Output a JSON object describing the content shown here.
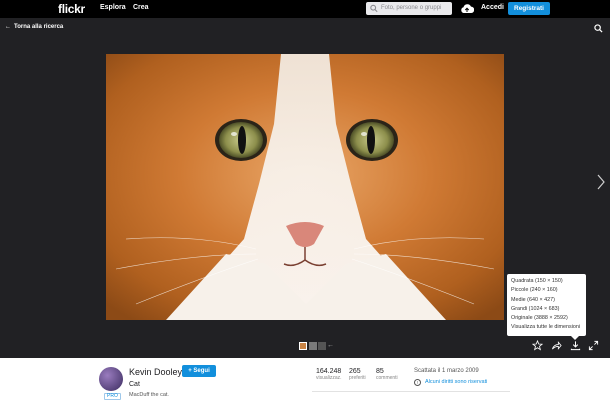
{
  "header": {
    "logo": "flickr",
    "nav": [
      "Esplora",
      "Crea"
    ],
    "search_placeholder": "Foto, persone o gruppi",
    "login": "Accedi",
    "signup": "Registrati"
  },
  "viewer": {
    "back_label": "Torna alla ricerca"
  },
  "download_menu": {
    "items": [
      "Quadrata (150 × 150)",
      "Piccole (240 × 160)",
      "Medie (640 × 427)",
      "Grandi (1024 × 683)",
      "Originale (3888 × 2592)",
      "Visualizza tutte le dimensioni"
    ]
  },
  "photo_info": {
    "author": "Kevin Dooley",
    "follow": "+ Segui",
    "title": "Cat",
    "description": "MacDuff the cat.",
    "pro_badge": "PRO",
    "stats": [
      {
        "value": "164.248",
        "label": "visualizzaz."
      },
      {
        "value": "265",
        "label": "preferiti"
      },
      {
        "value": "85",
        "label": "commenti"
      }
    ],
    "taken": "Scattata il 1 marzo 2009",
    "rights": "Alcuni diritti sono riservati"
  },
  "icons": {
    "upload": "cloud-upload-icon",
    "search": "search-icon",
    "favorite": "star-icon",
    "share": "share-icon",
    "download": "download-icon",
    "fullscreen": "fullscreen-icon",
    "next": "chevron-right-icon",
    "back": "arrow-left-icon"
  },
  "colors": {
    "brand_blue": "#128fdc",
    "topbar": "#000000",
    "viewer_bg": "#212124"
  }
}
